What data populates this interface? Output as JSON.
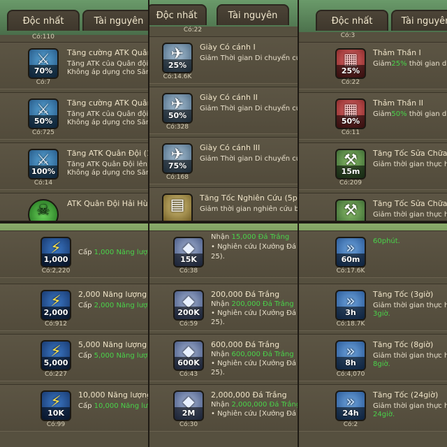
{
  "tabs": {
    "unique": "Độc nhất",
    "resources": "Tài nguyên"
  },
  "panel0": {
    "count_top": "Có:110",
    "rows": [
      {
        "title": "Tăng cường ATK Quân",
        "desc": "Tăng ATK của Quân đội th",
        "desc2": "Không áp dụng cho Săn",
        "value": "70%",
        "count": "Có:7",
        "icon": "sword-icon"
      },
      {
        "title": "Tăng cường ATK Quân",
        "desc": "Tăng ATK của Quân đội th",
        "desc2": "Không áp dụng cho Săn",
        "value": "50%",
        "count": "Có:725",
        "icon": "sword-icon"
      },
      {
        "title": "Tăng ATK Quân Đội (10",
        "desc": "Tăng ATK Quân Đội lên 1",
        "desc2": "Không áp dụng cho Săn",
        "value": "100%",
        "count": "Có:14",
        "icon": "sword-icon"
      },
      {
        "title": "ATK Quân Đội Hải Hùng",
        "desc": "",
        "desc2": "",
        "value": "",
        "count": "",
        "icon": "skull-icon"
      }
    ]
  },
  "panel1": {
    "count_top": "Có:22",
    "rows": [
      {
        "title": "Giày Có cánh I",
        "desc": "Giảm Thời gian Di chuyển củ",
        "value": "25%",
        "count": "Có:14.6K",
        "icon": "winged-boot-icon"
      },
      {
        "title": "Giày Có cánh II",
        "desc": "Giảm Thời gian Di chuyển củ",
        "value": "50%",
        "count": "Có:328",
        "icon": "winged-boot-icon"
      },
      {
        "title": "Giày Có cánh III",
        "desc": "Giảm Thời gian Di chuyển củ",
        "value": "75%",
        "count": "Có:168",
        "icon": "winged-boot-icon"
      },
      {
        "title": "Tăng Tốc Nghiên Cứu (5p",
        "desc": "Giảm thời gian nghiên cứu b",
        "value": "",
        "count": "",
        "icon": "research-book-icon"
      }
    ]
  },
  "panel2": {
    "count_top": "Có:3",
    "rows": [
      {
        "title": "Thảm Thần I",
        "desc_prefix": "Giảm",
        "desc_pct": "25%",
        "desc_suffix": " thời gian di",
        "value": "25%",
        "count": "Có:22",
        "icon": "magic-carpet-icon"
      },
      {
        "title": "Thảm Thần II",
        "desc_prefix": "Giảm",
        "desc_pct": "50%",
        "desc_suffix": " thời gian di",
        "value": "50%",
        "count": "Có:11",
        "icon": "magic-carpet-icon"
      },
      {
        "title": "Tăng Tốc Sửa Chữa T",
        "desc": "Giảm thời gian thực hi",
        "value": "15m",
        "count": "Có:209",
        "icon": "construction-icon"
      },
      {
        "title": "Tăng Tốc Sửa Chữa T",
        "desc": "Giảm thời gian thực hi",
        "value": "",
        "count": "",
        "icon": "construction-icon"
      }
    ]
  },
  "panel3": {
    "top": {
      "value": "1,000",
      "desc_prefix": "Cấp ",
      "desc_green": "1,000 Năng lượ",
      "count": "Có:2,220"
    },
    "rows": [
      {
        "title": "2,000 Năng lượng",
        "desc_prefix": "Cấp ",
        "desc_green": "2,000 Năng lượ",
        "value": "2,000",
        "count": "Có:912",
        "icon": "lightning-icon"
      },
      {
        "title": "5,000 Năng lượng",
        "desc_prefix": "Cấp ",
        "desc_green": "5,000 Năng lượ",
        "value": "5,000",
        "count": "Có:227",
        "icon": "lightning-icon"
      },
      {
        "title": "10,000 Năng lượng",
        "desc_prefix": "Cấp ",
        "desc_green": "10,000 Năng lượ",
        "value": "10K",
        "count": "Có:99",
        "icon": "lightning-icon"
      }
    ]
  },
  "panel4": {
    "top": {
      "value": "15K",
      "desc_prefix": "Nhận ",
      "desc_green": "15,000 Đá Trắng",
      "desc2": "• Nghiên cứu [Xưởng Đá",
      "desc3": "25).",
      "count": "Có:38"
    },
    "rows": [
      {
        "title": "200,000 Đá Trắng",
        "desc_prefix": "Nhận ",
        "desc_green": "200,000 Đá Trắng",
        "desc2": "• Nghiên cứu [Xưởng Đá",
        "desc3": "25).",
        "value": "200K",
        "count": "Có:59",
        "icon": "crystal-icon"
      },
      {
        "title": "600,000 Đá Trắng",
        "desc_prefix": "Nhận ",
        "desc_green": "600,000 Đá Trắng",
        "desc2": "• Nghiên cứu [Xưởng Đá",
        "desc3": "25).",
        "value": "600K",
        "count": "Có:43",
        "icon": "crystal-icon"
      },
      {
        "title": "2,000,000 Đá Trắng",
        "desc_prefix": "Nhận ",
        "desc_green": "2,000,000 Đá Trắng",
        "desc2": "• Nghiên cứu [Xưởng Đá",
        "desc3": "",
        "value": "2M",
        "count": "Có:30",
        "icon": "crystal-icon"
      }
    ]
  },
  "panel5": {
    "top": {
      "value": "60m",
      "desc_green": "60phút.",
      "count": "Có:17.6K"
    },
    "rows": [
      {
        "title": "Tăng Tốc (3giờ)",
        "desc": "Giảm thời gian thực hi",
        "desc_green": "3giờ.",
        "value": "3h",
        "count": "Có:18.7K",
        "icon": "speed-arrows-icon"
      },
      {
        "title": "Tăng Tốc (8giờ)",
        "desc": "Giảm thời gian thực hi",
        "desc_green": "8giờ.",
        "value": "8h",
        "count": "Có:4,070",
        "icon": "speed-arrows-icon"
      },
      {
        "title": "Tăng Tốc (24giờ)",
        "desc": "Giảm thời gian thực hi",
        "desc_green": "24giờ.",
        "value": "24h",
        "count": "Có:2",
        "icon": "speed-arrows-icon"
      }
    ]
  }
}
